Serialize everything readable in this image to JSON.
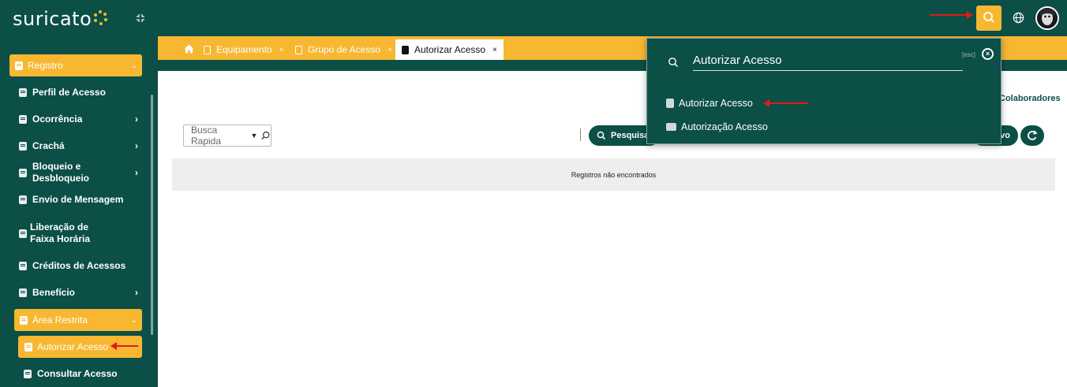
{
  "app": {
    "logo_text": "suricato"
  },
  "colors": {
    "primary": "#0b4f47",
    "accent": "#f7b731",
    "arrow": "#e01b1b"
  },
  "sidebar": {
    "registro_group": "Registro",
    "items": [
      {
        "label": "Perfil de Acesso",
        "chevron": false
      },
      {
        "label": "Ocorrência",
        "chevron": true
      },
      {
        "label": "Crachá",
        "chevron": true
      },
      {
        "label": "Bloqueio e Desbloqueio",
        "chevron": true
      },
      {
        "label": "Envio de Mensagem",
        "chevron": false
      },
      {
        "label": "Liberação de Faixa Horária",
        "chevron": false
      },
      {
        "label": "Créditos de Acessos",
        "chevron": false
      },
      {
        "label": "Benefício",
        "chevron": true
      }
    ],
    "area_group": "Área Restrita",
    "active_item": "Autorizar Acesso",
    "consultar": "Consultar Acesso"
  },
  "tabs": [
    {
      "label": "Equipamento",
      "close": "×"
    },
    {
      "label": "Grupo de Acesso",
      "close": "×"
    },
    {
      "label": "Autorizar Acesso",
      "close": "×",
      "active": true
    }
  ],
  "main": {
    "quick_search_placeholder": "Busca Rapida",
    "search_button": "Pesquisar",
    "novo_button": "Novo",
    "colaboradores_link": "Colaboradores",
    "empty_message": "Registros não encontrados"
  },
  "search_popup": {
    "query": "Autorizar Acesso",
    "esc_label": "[esc]",
    "close_glyph": "×",
    "results": [
      {
        "label": "Autorizar Acesso",
        "icon": "badge-icon"
      },
      {
        "label": "Autorização Acesso",
        "icon": "id-card-icon"
      }
    ]
  }
}
